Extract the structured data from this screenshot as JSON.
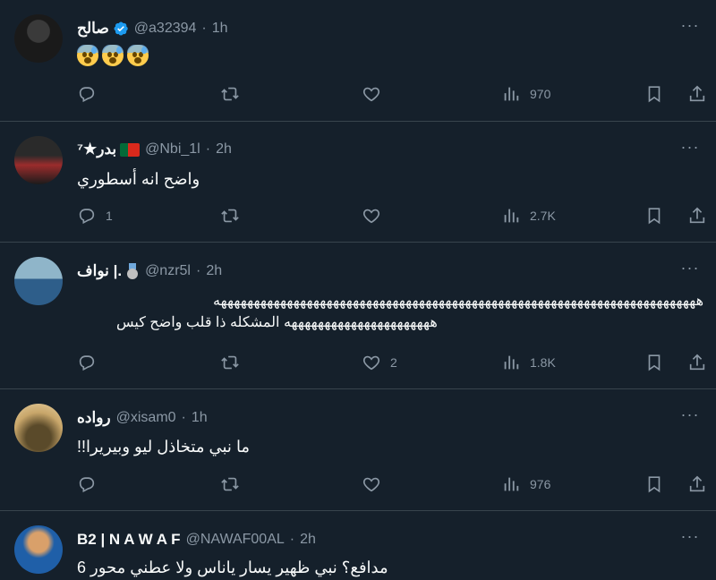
{
  "tweets": [
    {
      "name": "صالح",
      "handle": "@a32394",
      "dot": "·",
      "time": "1h",
      "verified": true,
      "text": "",
      "emojis": [
        "anxious-face-with-sweat",
        "anxious-face-with-sweat",
        "anxious-face-with-sweat"
      ],
      "replies": "",
      "likes": "",
      "views": "970"
    },
    {
      "name": "بدر★⁷",
      "handle": "@Nbi_1l",
      "dot": "·",
      "time": "2h",
      "text": "واضح انه أسطوري",
      "replies": "1",
      "likes": "",
      "views": "2.7K"
    },
    {
      "name": ".| نواف",
      "handle": "@nzr5l",
      "dot": "·",
      "time": "2h",
      "text_line1": "هههههههههههههههههههههههههههههههههههههههههههههههههههههههههههههههههههههههههه",
      "text_line2": "ههههههههههههههههههههههه  المشكله ذا قلب واضح كيس",
      "replies": "",
      "likes": "2",
      "views": "1.8K"
    },
    {
      "name": "رواده",
      "handle": "@xisam0",
      "dot": "·",
      "time": "1h",
      "text": "ما نبي متخاذل ليو وبيريرا!!",
      "replies": "",
      "likes": "",
      "views": "976"
    },
    {
      "name": "B2 | N A W A F",
      "handle": "@NAWAF00AL",
      "dot": "·",
      "time": "2h",
      "text": "مدافع؟ نبي ظهير يسار ياناس ولا عطني محور 6"
    }
  ],
  "icons": {
    "reply": "reply-icon",
    "retweet": "retweet-icon",
    "like": "heart-icon",
    "views": "views-icon",
    "bookmark": "bookmark-icon",
    "share": "share-icon",
    "more": "more-icon"
  },
  "colors": {
    "background": "#15202b",
    "divider": "#38444d",
    "muted": "#8b98a5",
    "text": "#f7f9f9",
    "verified": "#1d9bf0"
  }
}
